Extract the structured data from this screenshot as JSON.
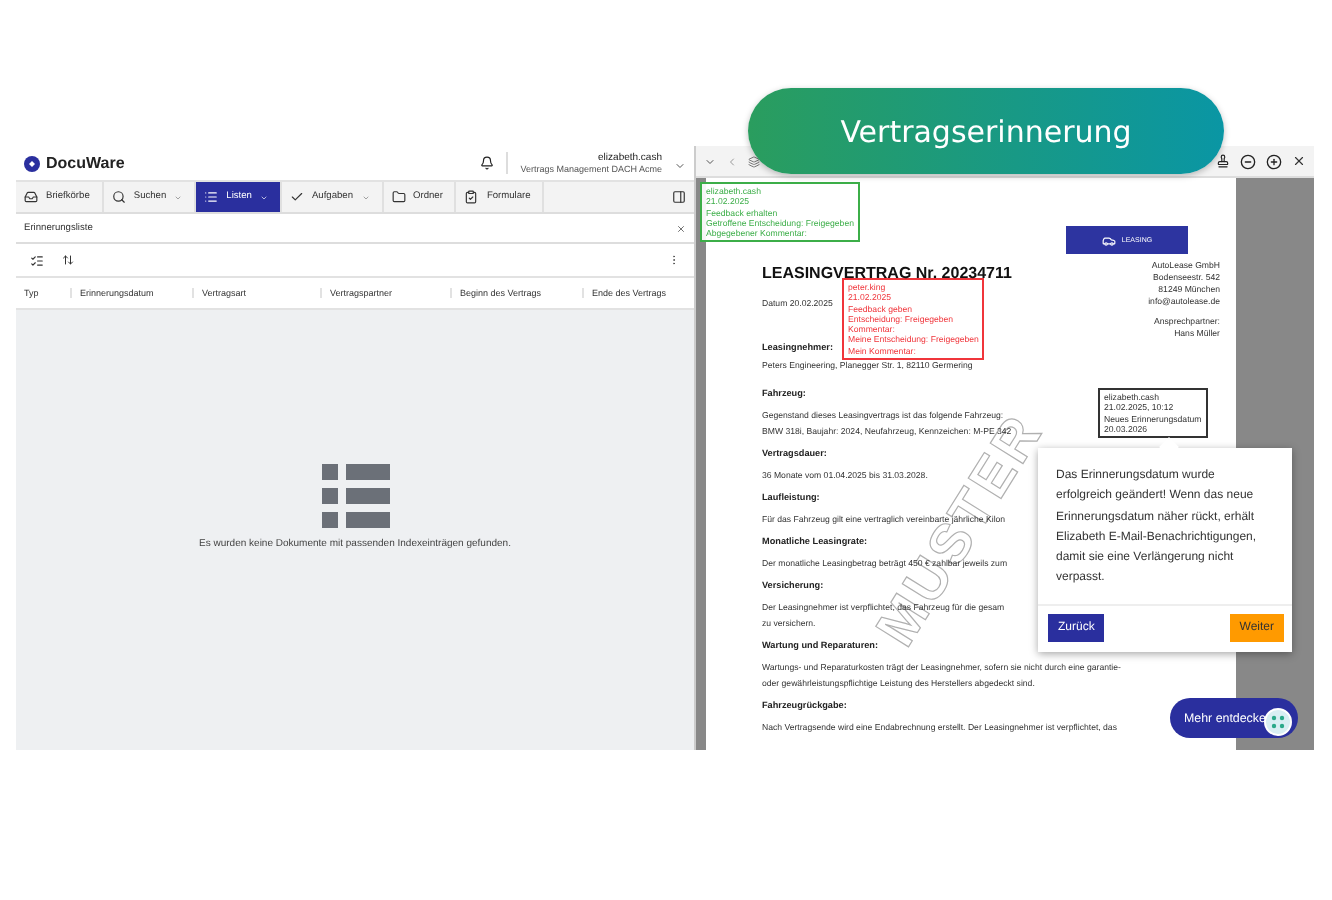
{
  "banner": {
    "label": "Vertragserinnerung"
  },
  "app": {
    "logo": "DocuWare",
    "user": "elizabeth.cash",
    "organization": "Vertrags Management DACH Acme"
  },
  "nav": [
    {
      "label": "Briefkörbe",
      "dropdown": false,
      "selected": false
    },
    {
      "label": "Suchen",
      "dropdown": true,
      "selected": false
    },
    {
      "label": "Listen",
      "dropdown": true,
      "selected": true
    },
    {
      "label": "Aufgaben",
      "dropdown": true,
      "selected": false
    },
    {
      "label": "Ordner",
      "dropdown": false,
      "selected": false
    },
    {
      "label": "Formulare",
      "dropdown": false,
      "selected": false
    }
  ],
  "list_panel": {
    "title": "Erinnerungsliste",
    "columns": [
      "Typ",
      "Erinnerungsdatum",
      "Vertragsart",
      "Vertragspartner",
      "Beginn des Vertrags",
      "Ende des Vertrags"
    ],
    "empty_message": "Es wurden keine Dokumente mit passenden Indexeinträgen gefunden."
  },
  "document": {
    "title": "LEASINGVERTRAG Nr. 20234711",
    "date": "Datum 20.02.2025",
    "logo": "LEASING",
    "company": [
      "AutoLease GmbH",
      "Bodenseestr. 542",
      "81249 München",
      "info@autolease.de"
    ],
    "contact_label": "Ansprechpartner:",
    "contact_name": "Hans Müller",
    "lessee_heading": "Leasingnehmer:",
    "lessee": "Peters Engineering, Planegger Str. 1, 82110 Germering",
    "stamp": "MUSTER",
    "sections": [
      {
        "heading": "Fahrzeug:",
        "lines": [
          "Gegenstand dieses Leasingvertrags ist das folgende Fahrzeug:",
          "BMW 318i, Baujahr: 2024, Neufahrzeug, Kennzeichen: M-PE 342"
        ]
      },
      {
        "heading": "Vertragsdauer:",
        "lines": [
          "36 Monate vom 01.04.2025 bis 31.03.2028."
        ]
      },
      {
        "heading": "Laufleistung:",
        "lines": [
          "Für das Fahrzeug gilt eine vertraglich vereinbarte jährliche Kilon"
        ]
      },
      {
        "heading": "Monatliche Leasingrate:",
        "lines": [
          "Der monatliche Leasingbetrag beträgt 450 € zahlbar jeweils zum"
        ]
      },
      {
        "heading": "Versicherung:",
        "lines": [
          "Der Leasingnehmer ist verpflichtet, das Fahrzeug für die gesam",
          "zu versichern."
        ]
      },
      {
        "heading": "Wartung und Reparaturen:",
        "lines": [
          "Wartungs- und Reparaturkosten trägt der Leasingnehmer, sofern sie nicht durch eine garantie-",
          "oder gewährleistungspflichtige Leistung des Herstellers abgedeckt sind."
        ]
      },
      {
        "heading": "Fahrzeugrückgabe:",
        "lines": [
          "Nach Vertragsende wird eine Endabrechnung erstellt. Der Leasingnehmer ist verpflichtet, das"
        ]
      }
    ]
  },
  "annotations": [
    {
      "color": "#3cae48",
      "lines": [
        "elizabeth.cash",
        "21.02.2025",
        "Feedback erhalten",
        "Getroffene Entscheidung: Freigegeben",
        "Abgegebener Kommentar:"
      ]
    },
    {
      "color": "#f0353b",
      "lines": [
        "peter.king",
        "21.02.2025",
        "Feedback geben",
        "Entscheidung: Freigegeben",
        "Kommentar:",
        "Meine Entscheidung: Freigegeben",
        "Mein Kommentar:"
      ]
    },
    {
      "color": "#333333",
      "lines": [
        "elizabeth.cash",
        "21.02.2025, 10:12",
        "Neues Erinnerungsdatum",
        "20.03.2026"
      ]
    }
  ],
  "tooltip": {
    "text": "Das Erinnerungsdatum wurde erfolgreich geändert! Wenn das neue Erinnerungsdatum näher rückt, erhält Elizabeth E-Mail-Benachrichtigungen, damit sie eine Verlängerung nicht verpasst.",
    "buttons": [
      {
        "label": "Zurück",
        "kind": "back"
      },
      {
        "label": "Weiter",
        "kind": "next"
      }
    ]
  },
  "discover_button": {
    "label": "Mehr entdecke"
  }
}
